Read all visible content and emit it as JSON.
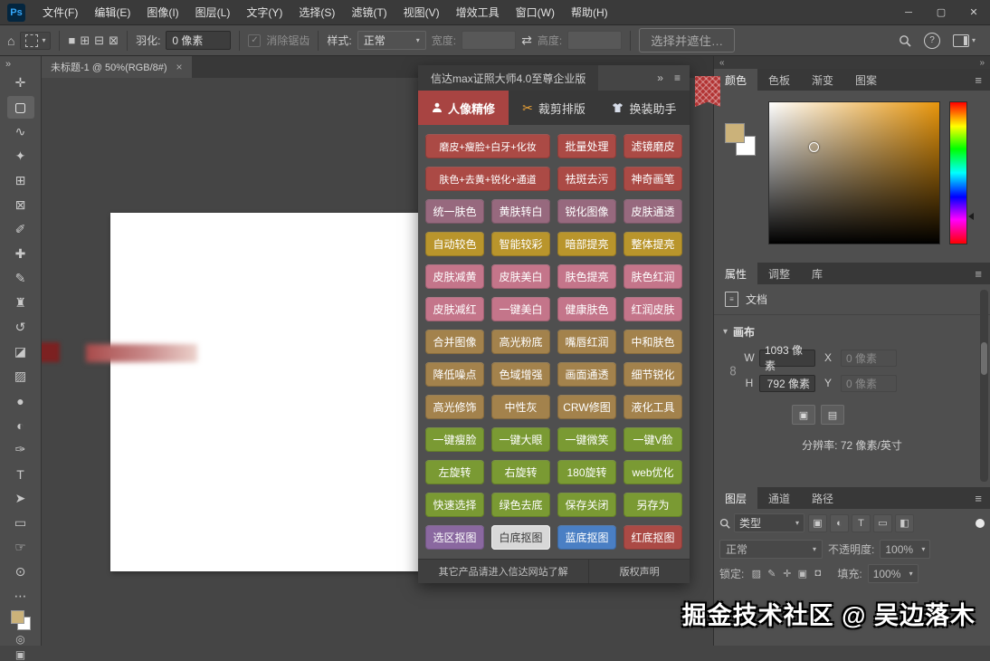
{
  "titlebar": {
    "logo_text": "Ps",
    "menus": [
      "文件(F)",
      "编辑(E)",
      "图像(I)",
      "图层(L)",
      "文字(Y)",
      "选择(S)",
      "滤镜(T)",
      "视图(V)",
      "增效工具",
      "窗口(W)",
      "帮助(H)"
    ],
    "minimize": "─",
    "maximize": "▢",
    "close": "✕"
  },
  "options_bar": {
    "feather_label": "羽化:",
    "feather_value": "0 像素",
    "antialias_label": "消除锯齿",
    "style_label": "样式:",
    "style_value": "正常",
    "width_label": "宽度:",
    "swap_glyph": "⇄",
    "height_label": "高度:",
    "select_and_mask": "选择并遮住…",
    "selection_modes": [
      {
        "name": "new-selection-icon",
        "glyph": "■"
      },
      {
        "name": "add-to-selection-icon",
        "glyph": "⊞"
      },
      {
        "name": "subtract-from-selection-icon",
        "glyph": "⊟"
      },
      {
        "name": "intersect-selection-icon",
        "glyph": "⊠"
      }
    ]
  },
  "document_tab": {
    "title": "未标题-1 @ 50%(RGB/8#)",
    "close_glyph": "×"
  },
  "toolbar": {
    "collapse_glyph": "»",
    "tools": [
      {
        "name": "move-tool",
        "glyph": "✛"
      },
      {
        "name": "marquee-tool",
        "glyph": "▢",
        "active": true
      },
      {
        "name": "lasso-tool",
        "glyph": "∿"
      },
      {
        "name": "quick-selection-tool",
        "glyph": "✦"
      },
      {
        "name": "crop-tool",
        "glyph": "⊞"
      },
      {
        "name": "frame-tool",
        "glyph": "⊠"
      },
      {
        "name": "eyedropper-tool",
        "glyph": "✐"
      },
      {
        "name": "healing-brush-tool",
        "glyph": "✚"
      },
      {
        "name": "brush-tool",
        "glyph": "✎"
      },
      {
        "name": "clone-stamp-tool",
        "glyph": "♜"
      },
      {
        "name": "history-brush-tool",
        "glyph": "↺"
      },
      {
        "name": "eraser-tool",
        "glyph": "◪"
      },
      {
        "name": "gradient-tool",
        "glyph": "▨"
      },
      {
        "name": "blur-tool",
        "glyph": "●"
      },
      {
        "name": "dodge-tool",
        "glyph": "◐"
      },
      {
        "name": "pen-tool",
        "glyph": "✑"
      },
      {
        "name": "type-tool",
        "glyph": "T"
      },
      {
        "name": "path-selection-tool",
        "glyph": "➤"
      },
      {
        "name": "rectangle-tool",
        "glyph": "▭"
      },
      {
        "name": "hand-tool",
        "glyph": "☞"
      },
      {
        "name": "zoom-tool",
        "glyph": "⊙"
      },
      {
        "name": "more-tools",
        "glyph": "⋯"
      }
    ]
  },
  "plugin": {
    "title": "信达max证照大师4.0至尊企业版",
    "collapse_glyph": "»",
    "menu_glyph": "≡",
    "tabs": [
      {
        "label": "人像精修",
        "icon": "person-icon"
      },
      {
        "label": "裁剪排版",
        "icon": "scissors-icon"
      },
      {
        "label": "换装助手",
        "icon": "shirt-icon"
      }
    ],
    "rows": [
      {
        "color": "red",
        "wide": true,
        "buttons": [
          "磨皮+瘦脸+白牙+化妆",
          "批量处理",
          "滤镜磨皮"
        ]
      },
      {
        "color": "red",
        "wide": true,
        "buttons": [
          "肤色+去黄+锐化+通道",
          "祛斑去污",
          "神奇画笔"
        ]
      },
      {
        "color": "mauve",
        "buttons": [
          "统一肤色",
          "黄肤转白",
          "锐化图像",
          "皮肤通透"
        ]
      },
      {
        "color": "gold",
        "buttons": [
          "自动较色",
          "智能较彩",
          "暗部提亮",
          "整体提亮"
        ]
      },
      {
        "color": "pink",
        "buttons": [
          "皮肤减黄",
          "皮肤美白",
          "肤色提亮",
          "肤色红润"
        ]
      },
      {
        "color": "pink",
        "buttons": [
          "皮肤减红",
          "一键美白",
          "健康肤色",
          "红润皮肤"
        ]
      },
      {
        "color": "tan",
        "buttons": [
          "合并图像",
          "高光粉底",
          "嘴唇红润",
          "中和肤色"
        ]
      },
      {
        "color": "tan",
        "buttons": [
          "降低噪点",
          "色域增强",
          "画面通透",
          "细节锐化"
        ]
      },
      {
        "color": "tan",
        "buttons": [
          "高光修饰",
          "中性灰",
          "CRW修图",
          "液化工具"
        ]
      },
      {
        "color": "green",
        "buttons": [
          "一键瘦脸",
          "一键大眼",
          "一键微笑",
          "一键V脸"
        ]
      },
      {
        "color": "green",
        "buttons": [
          "左旋转",
          "右旋转",
          "180旋转",
          "web优化"
        ]
      },
      {
        "color": "green",
        "buttons": [
          "快速选择",
          "绿色去底",
          "保存关闭",
          "另存为"
        ]
      },
      {
        "colors": [
          "purple",
          "white",
          "blue",
          "red"
        ],
        "buttons": [
          "选区抠图",
          "白底抠图",
          "蓝底抠图",
          "红底抠图"
        ]
      }
    ],
    "footer_left": "其它产品请进入信达网站了解",
    "footer_right": "版权声明"
  },
  "right_dock": {
    "collapse_left": "«",
    "collapse_right": "»"
  },
  "color_panel": {
    "tabs": [
      "颜色",
      "色板",
      "渐变",
      "图案"
    ],
    "active_tab": "颜色"
  },
  "properties_panel": {
    "tabs": [
      "属性",
      "调整",
      "库"
    ],
    "active_tab": "属性",
    "document_label": "文档",
    "canvas_section_label": "画布",
    "w_label": "W",
    "w_value": "1093 像素",
    "x_label": "X",
    "x_value": "0 像素",
    "h_label": "H",
    "h_value": "792 像素",
    "y_label": "Y",
    "y_value": "0 像素",
    "resolution_text": "分辨率: 72 像素/英寸"
  },
  "layers_panel": {
    "tabs": [
      "图层",
      "通道",
      "路径"
    ],
    "active_tab": "图层",
    "filter_label": "类型",
    "filter_icons": [
      {
        "name": "filter-pixel-layers-icon",
        "glyph": "▣"
      },
      {
        "name": "filter-adjustment-layers-icon",
        "glyph": "◐"
      },
      {
        "name": "filter-type-layers-icon",
        "glyph": "T"
      },
      {
        "name": "filter-shape-layers-icon",
        "glyph": "▭"
      },
      {
        "name": "filter-smart-objects-icon",
        "glyph": "◧"
      }
    ],
    "blend_mode": "正常",
    "opacity_label": "不透明度:",
    "opacity_value": "100%",
    "lock_label": "锁定:",
    "lock_icons": [
      {
        "name": "lock-transparency-icon",
        "glyph": "▨"
      },
      {
        "name": "lock-paint-icon",
        "glyph": "✎"
      },
      {
        "name": "lock-move-icon",
        "glyph": "✛"
      },
      {
        "name": "lock-artboard-icon",
        "glyph": "▣"
      },
      {
        "name": "lock-all-icon",
        "glyph": "◘"
      }
    ],
    "fill_label": "填充:",
    "fill_value": "100%"
  },
  "watermark_text": "掘金技术社区 @ 吴边落木",
  "colors": {
    "button_red": "#ab4a45",
    "button_mauve": "#97697e",
    "button_gold": "#b9952c",
    "button_pink": "#c4758a",
    "button_tan": "#a3824c",
    "button_green": "#7a9a33",
    "button_purple": "#8a68a0",
    "button_blue": "#4a7fc4",
    "button_white": "#d8d8d8",
    "active_tab_red": "#a84442",
    "ps_logo_blue": "#34a6f8",
    "foreground_swatch": "#cbb27a",
    "picker_hue": "#e8960c"
  }
}
